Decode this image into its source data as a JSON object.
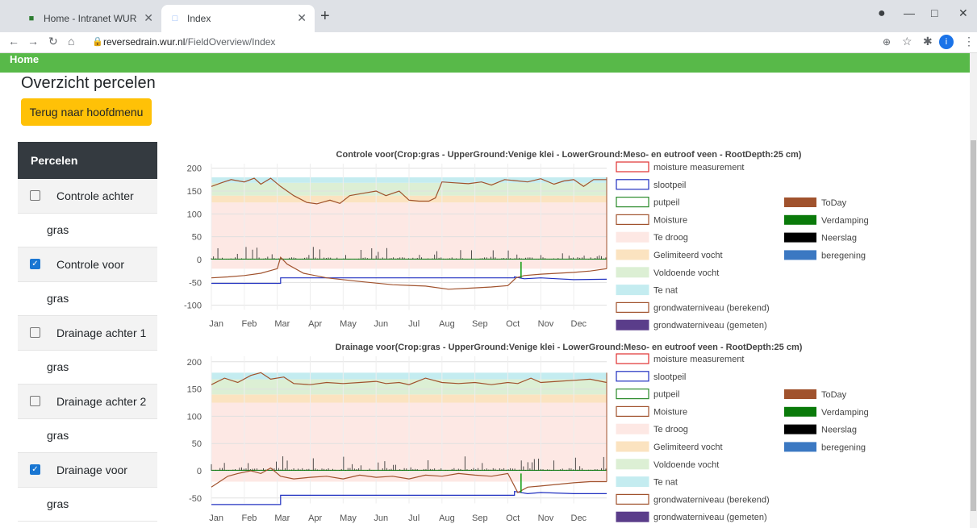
{
  "browser": {
    "tabs": [
      {
        "title": "Home - Intranet WUR",
        "active": false
      },
      {
        "title": "Index",
        "active": true
      }
    ],
    "url_host": "reversedrain.wur.nl",
    "url_path": "/FieldOverview/Index"
  },
  "navbar": {
    "home_label": "Home"
  },
  "page": {
    "title": "Overzicht percelen",
    "back_button": "Terug naar hoofdmenu"
  },
  "sidebar": {
    "header": "Percelen",
    "fields": [
      {
        "name": "Controle achter",
        "crop": "gras",
        "checked": false
      },
      {
        "name": "Controle voor",
        "crop": "gras",
        "checked": true
      },
      {
        "name": "Drainage achter 1",
        "crop": "gras",
        "checked": false
      },
      {
        "name": "Drainage achter 2",
        "crop": "gras",
        "checked": false
      },
      {
        "name": "Drainage voor",
        "crop": "gras",
        "checked": true
      }
    ]
  },
  "legend": {
    "left": [
      {
        "label": "moisture measurement",
        "style": "outline",
        "color": "#e03030"
      },
      {
        "label": "slootpeil",
        "style": "outline",
        "color": "#2030c0"
      },
      {
        "label": "putpeil",
        "style": "outline",
        "color": "#2a8a2a"
      },
      {
        "label": "Moisture",
        "style": "outline",
        "color": "#a0522d"
      },
      {
        "label": "Te droog",
        "style": "fill",
        "color": "#fde8e4"
      },
      {
        "label": "Gelimiteerd vocht",
        "style": "fill",
        "color": "#fbe3c0"
      },
      {
        "label": "Voldoende vocht",
        "style": "fill",
        "color": "#dcefd4"
      },
      {
        "label": "Te nat",
        "style": "fill",
        "color": "#c4ecf0"
      },
      {
        "label": "grondwaterniveau (berekend)",
        "style": "outline",
        "color": "#a0522d"
      },
      {
        "label": "grondwaterniveau (gemeten)",
        "style": "fill",
        "color": "#5a3d8a"
      }
    ],
    "right": [
      {
        "label": "ToDay",
        "color": "#a0522d"
      },
      {
        "label": "Verdamping",
        "color": "#0a7a0a"
      },
      {
        "label": "Neerslag",
        "color": "#000000"
      },
      {
        "label": "beregening",
        "color": "#3b78c2"
      }
    ]
  },
  "chart_data": [
    {
      "type": "line",
      "title": "Controle voor(Crop:gras - UpperGround:Venige klei - LowerGround:Meso- en eutroof veen - RootDepth:25 cm)",
      "x_ticks": [
        "Jan",
        "Feb",
        "Mar",
        "Apr",
        "May",
        "Jun",
        "Jul",
        "Aug",
        "Sep",
        "Oct",
        "Nov",
        "Dec"
      ],
      "y_ticks": [
        200,
        150,
        100,
        50,
        0,
        -50,
        -100
      ],
      "ylim": [
        -110,
        210
      ],
      "bands": [
        {
          "name": "Te droog",
          "from": -20,
          "to": 125
        },
        {
          "name": "Gelimiteerd vocht",
          "from": 125,
          "to": 140
        },
        {
          "name": "Voldoende vocht",
          "from": 140,
          "to": 168
        },
        {
          "name": "Te nat",
          "from": 168,
          "to": 180
        }
      ],
      "moisture": [
        [
          0,
          160
        ],
        [
          0.3,
          168
        ],
        [
          0.6,
          175
        ],
        [
          1,
          170
        ],
        [
          1.3,
          178
        ],
        [
          1.5,
          165
        ],
        [
          1.8,
          178
        ],
        [
          2.1,
          160
        ],
        [
          2.5,
          140
        ],
        [
          2.9,
          125
        ],
        [
          3.2,
          122
        ],
        [
          3.6,
          130
        ],
        [
          3.9,
          123
        ],
        [
          4.2,
          140
        ],
        [
          4.6,
          145
        ],
        [
          5,
          150
        ],
        [
          5.3,
          140
        ],
        [
          5.7,
          150
        ],
        [
          6,
          130
        ],
        [
          6.3,
          128
        ],
        [
          6.6,
          128
        ],
        [
          6.8,
          135
        ],
        [
          7,
          170
        ],
        [
          7.4,
          168
        ],
        [
          7.8,
          166
        ],
        [
          8.2,
          170
        ],
        [
          8.5,
          163
        ],
        [
          8.9,
          175
        ],
        [
          9.2,
          173
        ],
        [
          9.6,
          170
        ],
        [
          10,
          177
        ],
        [
          10.4,
          165
        ],
        [
          10.7,
          172
        ],
        [
          11,
          175
        ],
        [
          11.3,
          160
        ],
        [
          11.6,
          175
        ],
        [
          12,
          175
        ]
      ],
      "groundwater": [
        [
          0,
          -40
        ],
        [
          0.5,
          -38
        ],
        [
          1,
          -35
        ],
        [
          1.5,
          -30
        ],
        [
          2,
          -20
        ],
        [
          2.1,
          5
        ],
        [
          2.3,
          -10
        ],
        [
          2.8,
          -30
        ],
        [
          3.5,
          -40
        ],
        [
          4.5,
          -48
        ],
        [
          5.5,
          -55
        ],
        [
          6.5,
          -58
        ],
        [
          7.2,
          -65
        ],
        [
          8,
          -62
        ],
        [
          8.5,
          -60
        ],
        [
          9,
          -57
        ],
        [
          9.25,
          -40
        ],
        [
          9.5,
          -35
        ],
        [
          10,
          -32
        ],
        [
          10.5,
          -30
        ],
        [
          11,
          -28
        ],
        [
          11.5,
          -25
        ],
        [
          12,
          -20
        ]
      ],
      "ditch": [
        [
          0,
          -52
        ],
        [
          2.1,
          -52
        ],
        [
          2.1,
          -40
        ],
        [
          9.2,
          -40
        ],
        [
          9.2,
          -38
        ],
        [
          9.5,
          -42
        ],
        [
          10,
          -40
        ],
        [
          10.5,
          -42
        ],
        [
          11,
          -44
        ],
        [
          12,
          -43
        ]
      ],
      "today_month": 9.4
    },
    {
      "type": "line",
      "title": "Drainage voor(Crop:gras - UpperGround:Venige klei - LowerGround:Meso- en eutroof veen - RootDepth:25 cm)",
      "x_ticks": [
        "Jan",
        "Feb",
        "Mar",
        "Apr",
        "May",
        "Jun",
        "Jul",
        "Aug",
        "Sep",
        "Oct",
        "Nov",
        "Dec"
      ],
      "y_ticks": [
        200,
        150,
        100,
        50,
        0,
        -50
      ],
      "ylim": [
        -60,
        210
      ],
      "bands": [
        {
          "name": "Te droog",
          "from": -20,
          "to": 125
        },
        {
          "name": "Gelimiteerd vocht",
          "from": 125,
          "to": 140
        },
        {
          "name": "Voldoende vocht",
          "from": 140,
          "to": 168
        },
        {
          "name": "Te nat",
          "from": 168,
          "to": 180
        }
      ],
      "moisture": [
        [
          0,
          158
        ],
        [
          0.4,
          170
        ],
        [
          0.8,
          162
        ],
        [
          1.2,
          175
        ],
        [
          1.5,
          180
        ],
        [
          1.8,
          168
        ],
        [
          2.2,
          172
        ],
        [
          2.5,
          160
        ],
        [
          3,
          158
        ],
        [
          3.5,
          162
        ],
        [
          4,
          160
        ],
        [
          4.5,
          162
        ],
        [
          5,
          164
        ],
        [
          5.3,
          160
        ],
        [
          5.7,
          162
        ],
        [
          6,
          158
        ],
        [
          6.5,
          170
        ],
        [
          7,
          162
        ],
        [
          7.5,
          160
        ],
        [
          8,
          162
        ],
        [
          8.5,
          158
        ],
        [
          9,
          162
        ],
        [
          9.3,
          160
        ],
        [
          9.7,
          170
        ],
        [
          10,
          162
        ],
        [
          10.5,
          164
        ],
        [
          11,
          166
        ],
        [
          11.5,
          168
        ],
        [
          12,
          162
        ]
      ],
      "groundwater": [
        [
          0,
          -30
        ],
        [
          0.5,
          -10
        ],
        [
          0.8,
          -5
        ],
        [
          1.2,
          0
        ],
        [
          1.5,
          -5
        ],
        [
          1.8,
          5
        ],
        [
          2.1,
          -10
        ],
        [
          2.5,
          -15
        ],
        [
          3,
          -12
        ],
        [
          3.5,
          -10
        ],
        [
          4,
          -15
        ],
        [
          4.5,
          -8
        ],
        [
          5,
          -12
        ],
        [
          5.5,
          -10
        ],
        [
          6,
          -15
        ],
        [
          6.5,
          -8
        ],
        [
          7,
          -10
        ],
        [
          7.5,
          -5
        ],
        [
          8,
          -8
        ],
        [
          8.5,
          -10
        ],
        [
          9,
          -5
        ],
        [
          9.3,
          -40
        ],
        [
          9.6,
          -30
        ],
        [
          10,
          -28
        ],
        [
          10.5,
          -25
        ],
        [
          11,
          -22
        ],
        [
          11.5,
          -20
        ],
        [
          12,
          -20
        ]
      ],
      "ditch": [
        [
          0,
          -62
        ],
        [
          2.1,
          -62
        ],
        [
          2.1,
          -45
        ],
        [
          9.2,
          -45
        ],
        [
          9.2,
          -38
        ],
        [
          9.6,
          -42
        ],
        [
          10,
          -40
        ],
        [
          11,
          -42
        ],
        [
          12,
          -42
        ]
      ],
      "today_month": 9.4
    }
  ]
}
